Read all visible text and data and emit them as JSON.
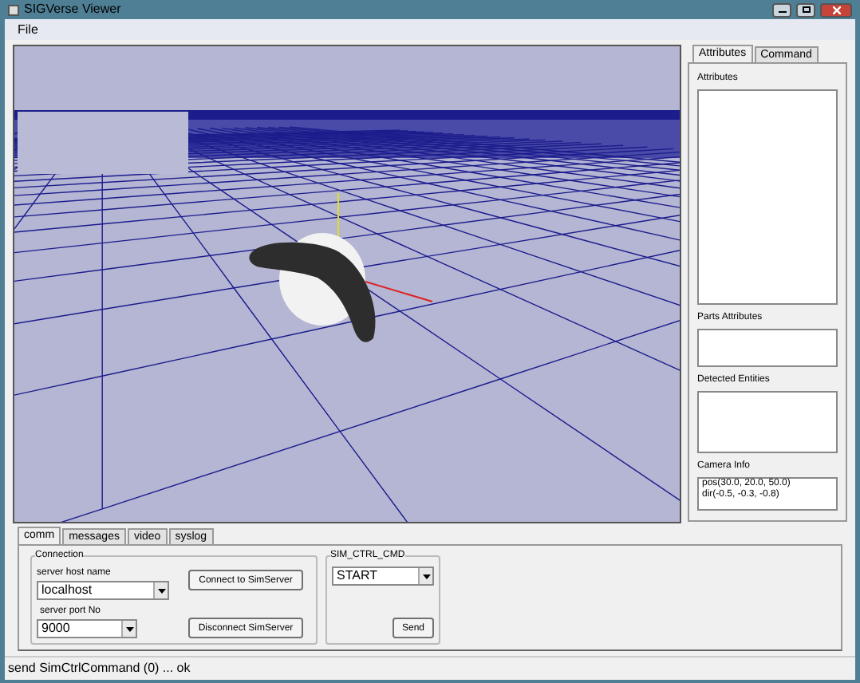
{
  "window": {
    "title": "SIGVerse Viewer"
  },
  "menu": [
    "File"
  ],
  "side_tabs": [
    {
      "label": "Attributes",
      "selected": true
    },
    {
      "label": "Command",
      "selected": false
    }
  ],
  "side_sections": [
    {
      "label": "Attributes"
    },
    {
      "label": "Parts Attributes"
    },
    {
      "label": "Detected Entities"
    },
    {
      "label": "Camera Info",
      "lines": [
        "pos(30.0, 20.0, 50.0)",
        "dir(-0.5, -0.3, -0.8)"
      ]
    }
  ],
  "bottom_tabs": [
    {
      "label": "comm",
      "selected": true
    },
    {
      "label": "messages",
      "selected": false
    },
    {
      "label": "video",
      "selected": false
    },
    {
      "label": "syslog",
      "selected": false
    }
  ],
  "connection": {
    "title": "Connection",
    "host_label": "server host name",
    "host_value": "localhost",
    "port_label": "server port No",
    "port_value": "9000",
    "connect_button": "Connect to SimServer",
    "disconnect_button": "Disconnect SimServer"
  },
  "sim_ctrl": {
    "title": "SIM_CTRL_CMD",
    "command": "START",
    "send_button": "Send"
  },
  "status_bar": {
    "text": "send SimCtrlCommand (0) ... ok"
  }
}
